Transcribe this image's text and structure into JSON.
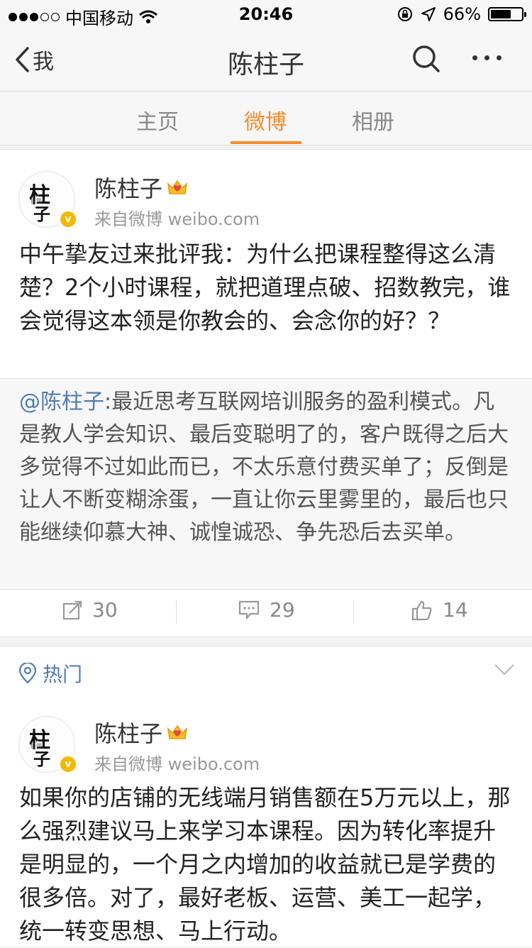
{
  "status_bar": {
    "carrier": "中国移动",
    "time": "20:46",
    "battery": "66%",
    "battery_level": 0.66,
    "signal_filled": 3,
    "signal_total": 5
  },
  "nav": {
    "back_label": "我",
    "title": "陈柱子"
  },
  "tabs": [
    {
      "label": "主页",
      "active": false
    },
    {
      "label": "微博",
      "active": true
    },
    {
      "label": "相册",
      "active": false
    }
  ],
  "accent_color": "#f98b2b",
  "link_color": "#4f7db3",
  "post1": {
    "author": "陈柱子",
    "source": "来自微博 weibo.com",
    "avatar_text": [
      "柱",
      "子"
    ],
    "text": "中午挚友过来批评我：为什么把课程整得这么清楚？2个小时课程，就把道理点破、招数教完，谁会觉得这本领是你教会的、会念你的好？？",
    "repost_mention": "@陈柱子",
    "repost_text": ":最近思考互联网培训服务的盈利模式。凡是教人学会知识、最后变聪明了的，客户既得之后大多觉得不过如此而已，不太乐意付费买单了；反倒是让人不断变糊涂蛋，一直让你云里雾里的，最后也只能继续仰慕大神、诚惶诚恐、争先恐后去买单。",
    "reposts": "30",
    "comments": "29",
    "likes": "14"
  },
  "hot_section": {
    "label": "热门"
  },
  "post2": {
    "author": "陈柱子",
    "source": "来自微博 weibo.com",
    "avatar_text": [
      "柱",
      "子"
    ],
    "text": "如果你的店铺的无线端月销售额在5万元以上，那么强烈建议马上来学习本课程。因为转化率提升是明显的，一个月之内增加的收益就已是学费的很多倍。对了，最好老板、运营、美工一起学，统一转变思想、马上行动。"
  }
}
